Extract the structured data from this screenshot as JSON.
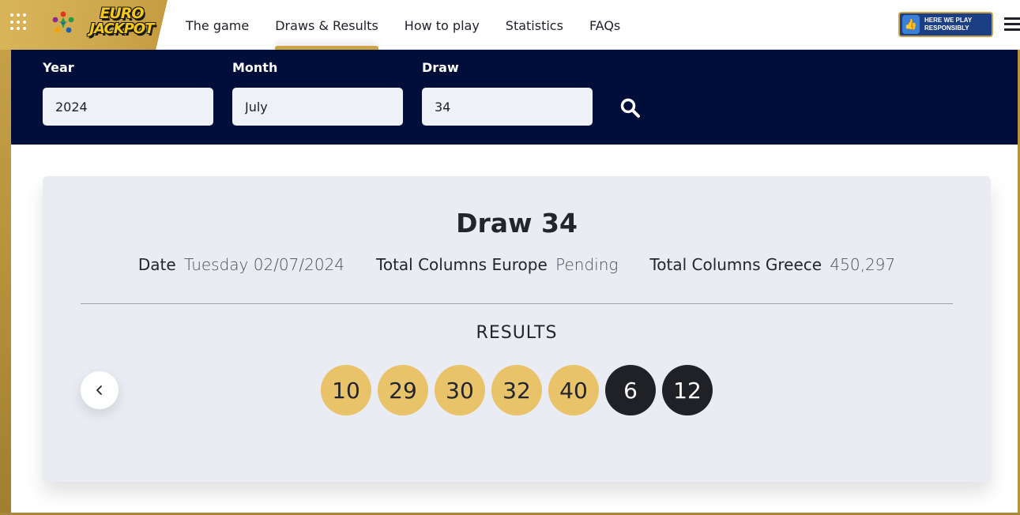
{
  "header": {
    "logo": {
      "line1": "EURO",
      "line2": "JACKPOT"
    },
    "nav": [
      {
        "label": "The game"
      },
      {
        "label": "Draws & Results"
      },
      {
        "label": "How to play"
      },
      {
        "label": "Statistics"
      },
      {
        "label": "FAQs"
      }
    ],
    "active_nav_index": 1,
    "responsibly_badge": {
      "line1": "HERE WE PLAY",
      "line2": "RESPONSIBLY"
    }
  },
  "filters": {
    "year": {
      "label": "Year",
      "value": "2024"
    },
    "month": {
      "label": "Month",
      "value": "July"
    },
    "draw": {
      "label": "Draw",
      "value": "34"
    }
  },
  "draw": {
    "title": "Draw 34",
    "date_label": "Date",
    "date_value": "Tuesday 02/07/2024",
    "europe_label": "Total Columns Europe",
    "europe_value": "Pending",
    "greece_label": "Total Columns Greece",
    "greece_value": "450,297",
    "results_heading": "RESULTS",
    "main_numbers": [
      "10",
      "29",
      "30",
      "32",
      "40"
    ],
    "euro_numbers": [
      "6",
      "12"
    ]
  },
  "colors": {
    "gold": "#c9a24a",
    "navy": "#010e3a",
    "ball_gold": "#e8c36a",
    "ball_dark": "#1f2126",
    "card_bg": "#e9edf3"
  },
  "icons": [
    "apps-grid-icon",
    "lottery-star-icon",
    "thumbs-up-icon",
    "menu-icon",
    "search-icon",
    "chevron-left-icon"
  ]
}
